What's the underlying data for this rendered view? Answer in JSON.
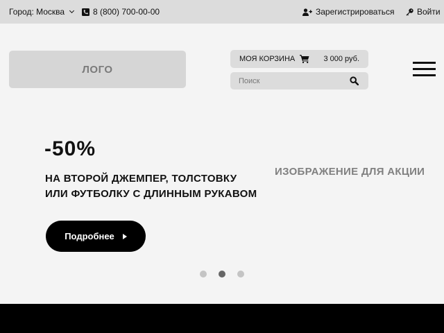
{
  "topbar": {
    "city_label": "Город: Москва",
    "phone": "8 (800) 700-00-00",
    "register": "Зарегистрироваться",
    "login": "Войти"
  },
  "header": {
    "logo": "ЛОГО",
    "cart": {
      "label": "МОЯ КОРЗИНА",
      "total": "3 000 руб."
    },
    "search": {
      "placeholder": "Поиск",
      "value": ""
    }
  },
  "promo": {
    "discount": "-50%",
    "line1": "НА ВТОРОЙ ДЖЕМПЕР, ТОЛСТОВКУ",
    "line2": "ИЛИ ФУТБОЛКУ С ДЛИННЫМ РУКАВОМ",
    "image_placeholder": "ИЗОБРАЖЕНИЕ ДЛЯ АКЦИИ",
    "button_label": "Подробнее"
  },
  "slider": {
    "total": 3,
    "active": 2
  },
  "icons": {
    "phone": "phone-icon",
    "register": "user-plus-icon",
    "login": "key-icon",
    "cart": "cart-icon",
    "search": "search-icon",
    "menu": "hamburger-icon",
    "dropdown": "chevron-down-icon",
    "arrow": "play-arrow-icon"
  },
  "colors": {
    "topbar_bg": "#dcdcdc",
    "page_bg": "#f4f4f4",
    "placeholder_bg": "#d6d6d6",
    "button_bg": "#000000",
    "dot_active": "#666666",
    "dot_inactive": "#c4c4c4"
  }
}
